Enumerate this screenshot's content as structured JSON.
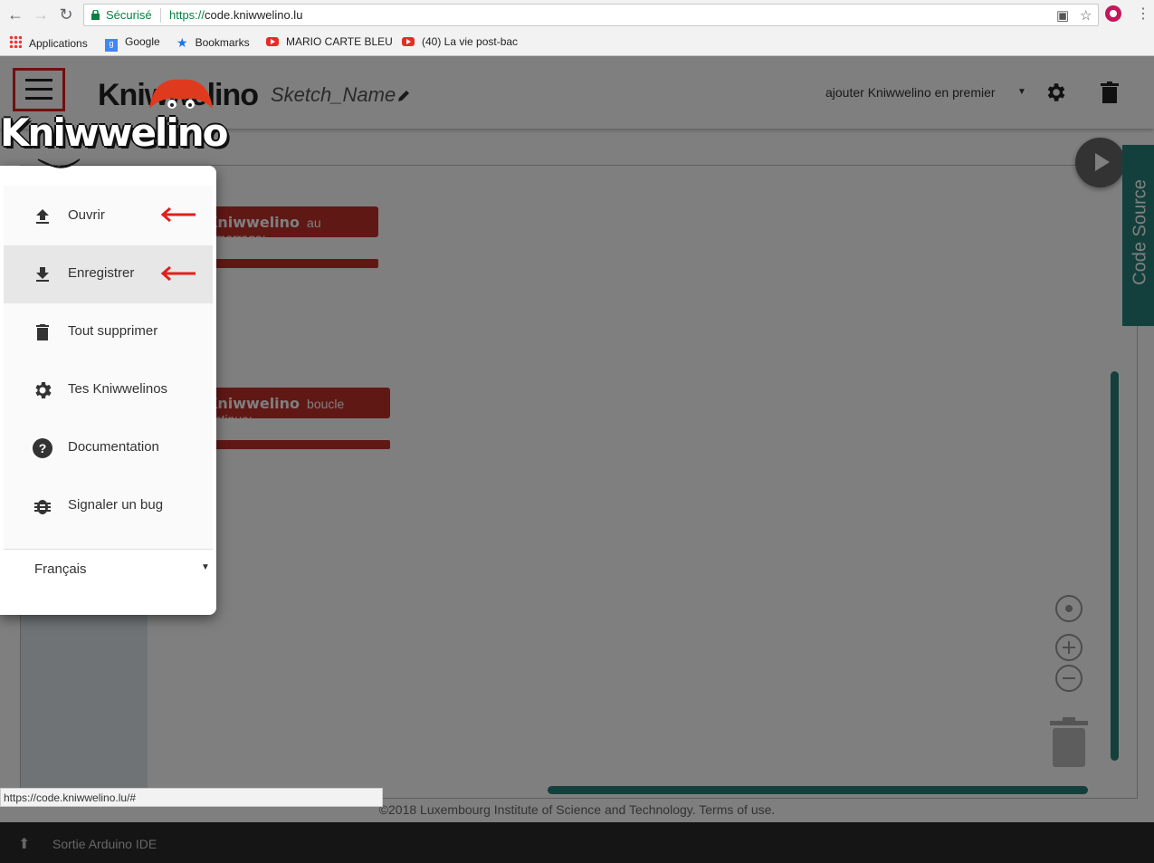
{
  "browser": {
    "secure_label": "Sécurisé",
    "url_scheme": "https://",
    "url_host": "code.kniwwelino.lu",
    "bookmarks": [
      {
        "label": "Applications",
        "icon": "apps-icon"
      },
      {
        "label": "Google",
        "icon": "google-icon"
      },
      {
        "label": "Bookmarks",
        "icon": "star-icon"
      },
      {
        "label": "MARIO CARTE BLEU",
        "icon": "youtube-icon"
      },
      {
        "label": "(40) La vie post-bac",
        "icon": "youtube-icon"
      }
    ],
    "status_url": "https://code.kniwwelino.lu/#"
  },
  "header": {
    "logo_text": "Kniwwelino",
    "sketch_name": "Sketch_Name",
    "board_option": "ajouter Kniwwelino en premier"
  },
  "workspace": {
    "code_tab_label": "Code Source",
    "blocks": [
      {
        "brand": "Kniwwelino",
        "label": "au démarrage:"
      },
      {
        "brand": "Kniwwelino",
        "label": "boucle continue:"
      }
    ]
  },
  "drawer": {
    "logo_text": "Kniwwelino",
    "items": [
      {
        "label": "Ouvrir",
        "icon": "upload-icon"
      },
      {
        "label": "Enregistrer",
        "icon": "download-icon"
      },
      {
        "label": "Tout supprimer",
        "icon": "trash-icon"
      },
      {
        "label": "Tes Kniwwelinos",
        "icon": "gear-icon"
      },
      {
        "label": "Documentation",
        "icon": "help-icon"
      },
      {
        "label": "Signaler un bug",
        "icon": "bug-icon"
      }
    ],
    "language": "Français"
  },
  "footer": {
    "copyright": "©2018 Luxembourg Institute of Science and Technology. Terms of use.",
    "serial_label": "Sortie Arduino IDE"
  },
  "colors": {
    "accent_teal": "#26807a",
    "block_red": "#c0312b",
    "highlight_red": "#e0201c"
  }
}
